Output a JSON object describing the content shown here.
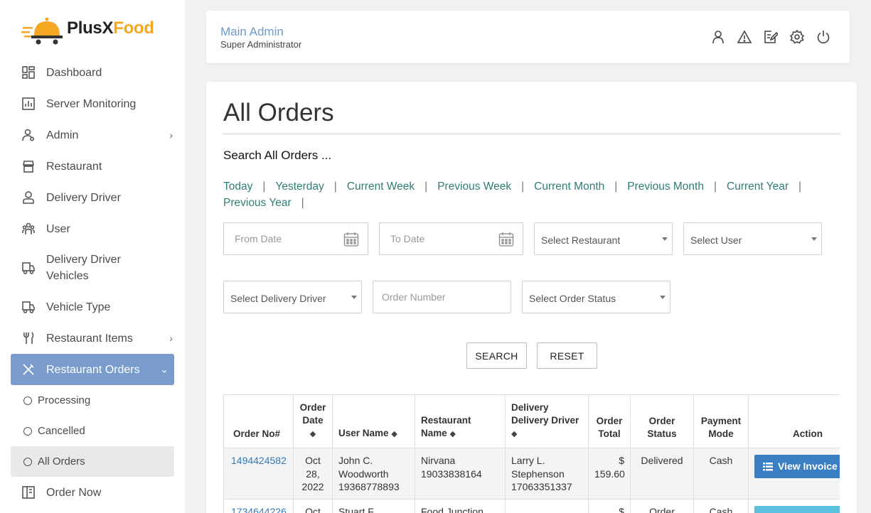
{
  "brand": {
    "part1": "PlusX",
    "part2": "Food",
    "accent": "#f5a623"
  },
  "header": {
    "admin_name": "Main Admin",
    "admin_role": "Super Administrator",
    "icons": [
      "user-icon",
      "alert-icon",
      "edit-icon",
      "settings-icon",
      "power-icon"
    ]
  },
  "sidebar": {
    "items": [
      {
        "label": "Dashboard",
        "icon": "dashboard-icon"
      },
      {
        "label": "Server Monitoring",
        "icon": "monitoring-icon"
      },
      {
        "label": "Admin",
        "icon": "admin-icon",
        "chevron": "›"
      },
      {
        "label": "Restaurant",
        "icon": "store-icon"
      },
      {
        "label": "Delivery Driver",
        "icon": "driver-icon"
      },
      {
        "label": "User",
        "icon": "users-icon"
      },
      {
        "label": "Delivery Driver Vehicles",
        "icon": "vehicle-icon"
      },
      {
        "label": "Vehicle Type",
        "icon": "vehicle-type-icon"
      },
      {
        "label": "Restaurant Items",
        "icon": "cutlery-icon",
        "chevron": "›"
      },
      {
        "label": "Restaurant Orders",
        "icon": "utensils-cross-icon",
        "chevron": "⌄"
      }
    ],
    "subitems": [
      "Processing",
      "Cancelled",
      "All Orders"
    ],
    "last_item": {
      "label": "Order Now",
      "icon": "book-icon"
    }
  },
  "page": {
    "title": "All Orders",
    "search_heading": "Search All Orders ...",
    "quick_links": [
      "Today",
      "Yesterday",
      "Current Week",
      "Previous Week",
      "Current Month",
      "Previous Month",
      "Current Year",
      "Previous Year"
    ],
    "separator": "|",
    "filters": {
      "from_date": "From Date",
      "to_date": "To Date",
      "restaurant": "Select Restaurant",
      "user": "Select User",
      "driver": "Select Delivery Driver",
      "order_number": "Order Number",
      "order_status": "Select Order Status"
    },
    "buttons": {
      "search": "SEARCH",
      "reset": "RESET"
    }
  },
  "table": {
    "headers": {
      "order_no": "Order No#",
      "order_date_1": "Order",
      "order_date_2": "Date",
      "user_name": "User Name",
      "restaurant_1": "Restaurant",
      "restaurant_2": "Name",
      "driver_1": "Delivery",
      "driver_2": "Delivery Driver",
      "total_1": "Order",
      "total_2": "Total",
      "status_1": "Order",
      "status_2": "Status",
      "payment_1": "Payment",
      "payment_2": "Mode",
      "action": "Action"
    },
    "sort_glyph": "◆",
    "rows": [
      {
        "order_no": "1494424582",
        "date_1": "Oct",
        "date_2": "28,",
        "date_3": "2022",
        "user_1": "John C.",
        "user_2": "Woodworth",
        "user_3": "19368778893",
        "rest_1": "Nirvana",
        "rest_2": "19033838164",
        "driver_1": "Larry L.",
        "driver_2": "Stephenson",
        "driver_3": "17063351337",
        "total_1": "$",
        "total_2": "159.60",
        "status": "Delivered",
        "payment": "Cash",
        "action": "View Invoice"
      },
      {
        "order_no": "1734644226",
        "date_1": "Oct",
        "user_1": "Stuart F.",
        "rest_1": "Food Junction",
        "total_1": "$",
        "status": "Order",
        "payment": "Cash"
      }
    ]
  }
}
